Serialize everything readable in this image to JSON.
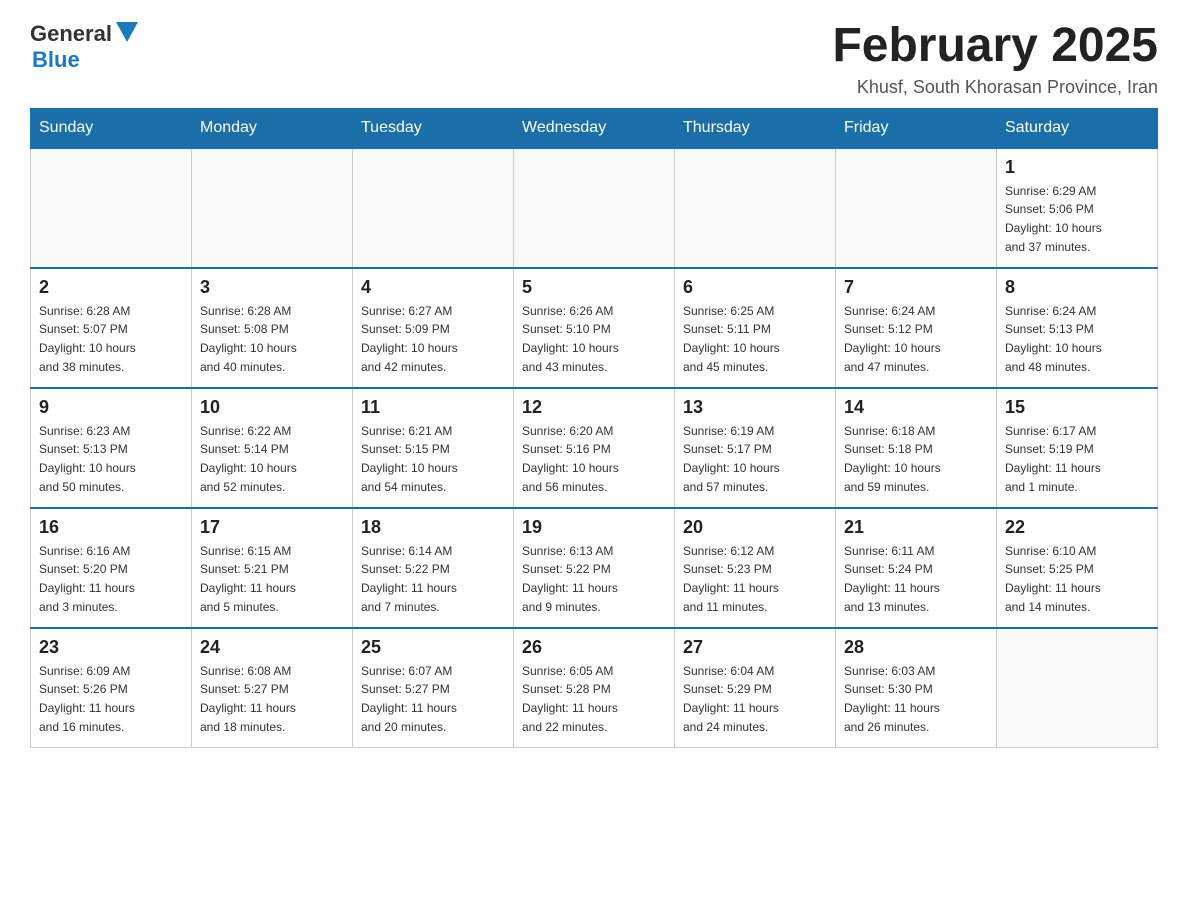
{
  "header": {
    "logo_general": "General",
    "logo_blue": "Blue",
    "title": "February 2025",
    "subtitle": "Khusf, South Khorasan Province, Iran"
  },
  "days_of_week": [
    "Sunday",
    "Monday",
    "Tuesday",
    "Wednesday",
    "Thursday",
    "Friday",
    "Saturday"
  ],
  "weeks": [
    {
      "days": [
        {
          "number": "",
          "info": ""
        },
        {
          "number": "",
          "info": ""
        },
        {
          "number": "",
          "info": ""
        },
        {
          "number": "",
          "info": ""
        },
        {
          "number": "",
          "info": ""
        },
        {
          "number": "",
          "info": ""
        },
        {
          "number": "1",
          "info": "Sunrise: 6:29 AM\nSunset: 5:06 PM\nDaylight: 10 hours\nand 37 minutes."
        }
      ]
    },
    {
      "days": [
        {
          "number": "2",
          "info": "Sunrise: 6:28 AM\nSunset: 5:07 PM\nDaylight: 10 hours\nand 38 minutes."
        },
        {
          "number": "3",
          "info": "Sunrise: 6:28 AM\nSunset: 5:08 PM\nDaylight: 10 hours\nand 40 minutes."
        },
        {
          "number": "4",
          "info": "Sunrise: 6:27 AM\nSunset: 5:09 PM\nDaylight: 10 hours\nand 42 minutes."
        },
        {
          "number": "5",
          "info": "Sunrise: 6:26 AM\nSunset: 5:10 PM\nDaylight: 10 hours\nand 43 minutes."
        },
        {
          "number": "6",
          "info": "Sunrise: 6:25 AM\nSunset: 5:11 PM\nDaylight: 10 hours\nand 45 minutes."
        },
        {
          "number": "7",
          "info": "Sunrise: 6:24 AM\nSunset: 5:12 PM\nDaylight: 10 hours\nand 47 minutes."
        },
        {
          "number": "8",
          "info": "Sunrise: 6:24 AM\nSunset: 5:13 PM\nDaylight: 10 hours\nand 48 minutes."
        }
      ]
    },
    {
      "days": [
        {
          "number": "9",
          "info": "Sunrise: 6:23 AM\nSunset: 5:13 PM\nDaylight: 10 hours\nand 50 minutes."
        },
        {
          "number": "10",
          "info": "Sunrise: 6:22 AM\nSunset: 5:14 PM\nDaylight: 10 hours\nand 52 minutes."
        },
        {
          "number": "11",
          "info": "Sunrise: 6:21 AM\nSunset: 5:15 PM\nDaylight: 10 hours\nand 54 minutes."
        },
        {
          "number": "12",
          "info": "Sunrise: 6:20 AM\nSunset: 5:16 PM\nDaylight: 10 hours\nand 56 minutes."
        },
        {
          "number": "13",
          "info": "Sunrise: 6:19 AM\nSunset: 5:17 PM\nDaylight: 10 hours\nand 57 minutes."
        },
        {
          "number": "14",
          "info": "Sunrise: 6:18 AM\nSunset: 5:18 PM\nDaylight: 10 hours\nand 59 minutes."
        },
        {
          "number": "15",
          "info": "Sunrise: 6:17 AM\nSunset: 5:19 PM\nDaylight: 11 hours\nand 1 minute."
        }
      ]
    },
    {
      "days": [
        {
          "number": "16",
          "info": "Sunrise: 6:16 AM\nSunset: 5:20 PM\nDaylight: 11 hours\nand 3 minutes."
        },
        {
          "number": "17",
          "info": "Sunrise: 6:15 AM\nSunset: 5:21 PM\nDaylight: 11 hours\nand 5 minutes."
        },
        {
          "number": "18",
          "info": "Sunrise: 6:14 AM\nSunset: 5:22 PM\nDaylight: 11 hours\nand 7 minutes."
        },
        {
          "number": "19",
          "info": "Sunrise: 6:13 AM\nSunset: 5:22 PM\nDaylight: 11 hours\nand 9 minutes."
        },
        {
          "number": "20",
          "info": "Sunrise: 6:12 AM\nSunset: 5:23 PM\nDaylight: 11 hours\nand 11 minutes."
        },
        {
          "number": "21",
          "info": "Sunrise: 6:11 AM\nSunset: 5:24 PM\nDaylight: 11 hours\nand 13 minutes."
        },
        {
          "number": "22",
          "info": "Sunrise: 6:10 AM\nSunset: 5:25 PM\nDaylight: 11 hours\nand 14 minutes."
        }
      ]
    },
    {
      "days": [
        {
          "number": "23",
          "info": "Sunrise: 6:09 AM\nSunset: 5:26 PM\nDaylight: 11 hours\nand 16 minutes."
        },
        {
          "number": "24",
          "info": "Sunrise: 6:08 AM\nSunset: 5:27 PM\nDaylight: 11 hours\nand 18 minutes."
        },
        {
          "number": "25",
          "info": "Sunrise: 6:07 AM\nSunset: 5:27 PM\nDaylight: 11 hours\nand 20 minutes."
        },
        {
          "number": "26",
          "info": "Sunrise: 6:05 AM\nSunset: 5:28 PM\nDaylight: 11 hours\nand 22 minutes."
        },
        {
          "number": "27",
          "info": "Sunrise: 6:04 AM\nSunset: 5:29 PM\nDaylight: 11 hours\nand 24 minutes."
        },
        {
          "number": "28",
          "info": "Sunrise: 6:03 AM\nSunset: 5:30 PM\nDaylight: 11 hours\nand 26 minutes."
        },
        {
          "number": "",
          "info": ""
        }
      ]
    }
  ]
}
